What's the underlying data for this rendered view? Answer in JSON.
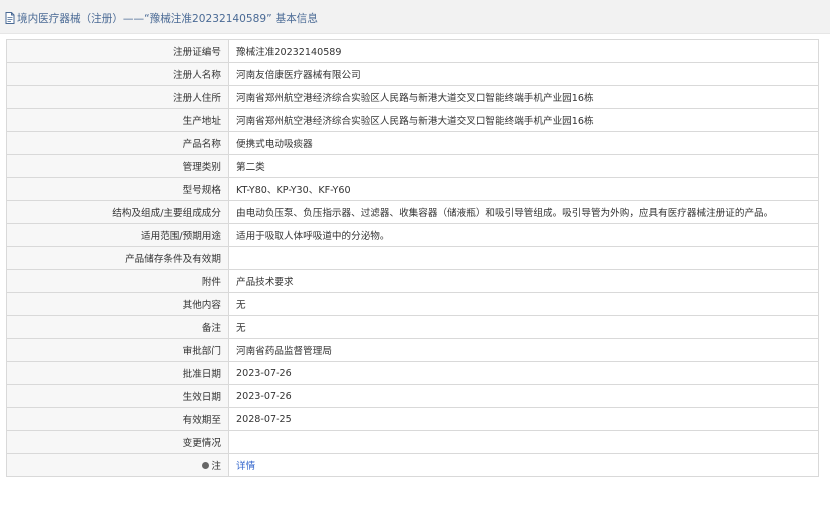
{
  "header": {
    "prefix": "境内医疗器械（注册）——",
    "link_text": "“豫械注准20232140589”",
    "suffix": "基本信息"
  },
  "rows": [
    {
      "label": "注册证编号",
      "value": "豫械注准20232140589"
    },
    {
      "label": "注册人名称",
      "value": "河南友倍康医疗器械有限公司"
    },
    {
      "label": "注册人住所",
      "value": "河南省郑州航空港经济综合实验区人民路与新港大道交叉口智能终端手机产业园16栋"
    },
    {
      "label": "生产地址",
      "value": "河南省郑州航空港经济综合实验区人民路与新港大道交叉口智能终端手机产业园16栋"
    },
    {
      "label": "产品名称",
      "value": "便携式电动吸痰器"
    },
    {
      "label": "管理类别",
      "value": "第二类"
    },
    {
      "label": "型号规格",
      "value": "KT-Y80、KP-Y30、KF-Y60"
    },
    {
      "label": "结构及组成/主要组成成分",
      "value": "由电动负压泵、负压指示器、过滤器、收集容器（储液瓶）和吸引导管组成。吸引导管为外购，应具有医疗器械注册证的产品。"
    },
    {
      "label": "适用范围/预期用途",
      "value": "适用于吸取人体呼吸道中的分泌物。"
    },
    {
      "label": "产品储存条件及有效期",
      "value": ""
    },
    {
      "label": "附件",
      "value": "产品技术要求"
    },
    {
      "label": "其他内容",
      "value": "无"
    },
    {
      "label": "备注",
      "value": "无"
    },
    {
      "label": "审批部门",
      "value": "河南省药品监督管理局"
    },
    {
      "label": "批准日期",
      "value": "2023-07-26"
    },
    {
      "label": "生效日期",
      "value": "2023-07-26"
    },
    {
      "label": "有效期至",
      "value": "2028-07-25"
    },
    {
      "label": "变更情况",
      "value": ""
    }
  ],
  "note_row": {
    "label": "注",
    "icon": "pin-icon",
    "link": "详情"
  }
}
